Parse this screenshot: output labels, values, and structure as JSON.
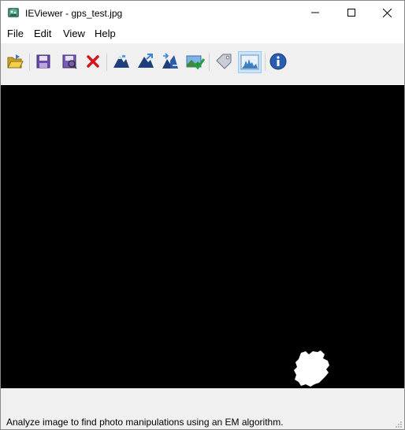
{
  "window": {
    "title": "IEViewer - gps_test.jpg"
  },
  "menu": {
    "items": [
      "File",
      "Edit",
      "View",
      "Help"
    ]
  },
  "toolbar": {
    "buttons": [
      {
        "icon": "open-folder-icon"
      },
      {
        "icon": "save-icon"
      },
      {
        "icon": "save-as-icon"
      },
      {
        "icon": "close-image-icon"
      },
      {
        "icon": "analyze-mountain-icon"
      },
      {
        "icon": "analyze-mountain-arrow-icon"
      },
      {
        "icon": "compare-mountain-icon"
      },
      {
        "icon": "accept-image-icon"
      },
      {
        "icon": "tag-icon"
      },
      {
        "icon": "histogram-icon",
        "active": true
      },
      {
        "icon": "info-icon"
      }
    ]
  },
  "status": {
    "text": "Analyze image to find photo manipulations using an EM algorithm."
  },
  "colors": {
    "canvas_bg": "#000000",
    "toolbar_bg": "#f0f0f0",
    "active_button": "#cce4f7"
  }
}
